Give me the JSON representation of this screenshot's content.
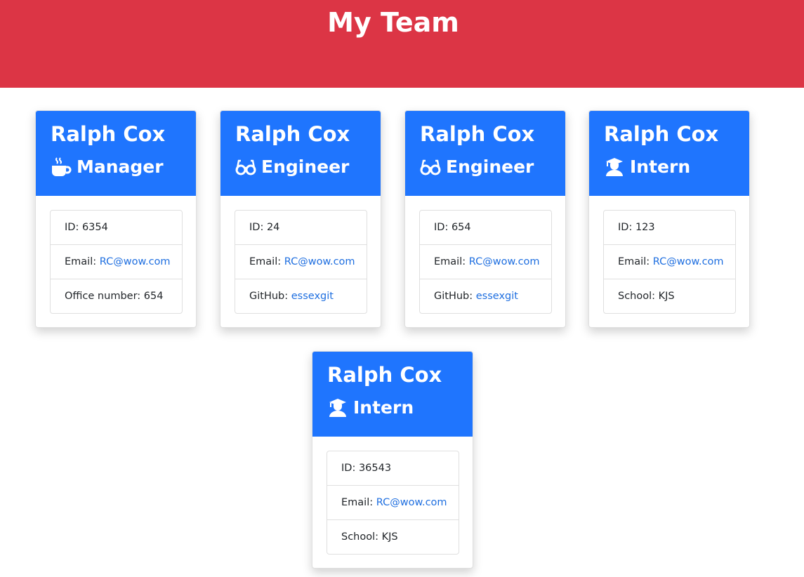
{
  "header": {
    "title": "My Team"
  },
  "cards": [
    {
      "name": "Ralph Cox",
      "role": "Manager",
      "role_icon": "mug-hot-icon",
      "id_label": "ID: ",
      "id": "6354",
      "email_label": "Email: ",
      "email": "RC@wow.com",
      "extra_label": "Office number: ",
      "extra_value": "654"
    },
    {
      "name": "Ralph Cox",
      "role": "Engineer",
      "role_icon": "glasses-icon",
      "id_label": "ID: ",
      "id": "24",
      "email_label": "Email: ",
      "email": "RC@wow.com",
      "extra_label": "GitHub: ",
      "extra_value": "essexgit"
    },
    {
      "name": "Ralph Cox",
      "role": "Engineer",
      "role_icon": "glasses-icon",
      "id_label": "ID: ",
      "id": "654",
      "email_label": "Email: ",
      "email": "RC@wow.com",
      "extra_label": "GitHub: ",
      "extra_value": "essexgit"
    },
    {
      "name": "Ralph Cox",
      "role": "Intern",
      "role_icon": "user-graduate-icon",
      "id_label": "ID: ",
      "id": "123",
      "email_label": "Email: ",
      "email": "RC@wow.com",
      "extra_label": "School: ",
      "extra_value": "KJS"
    },
    {
      "name": "Ralph Cox",
      "role": "Intern",
      "role_icon": "user-graduate-icon",
      "id_label": "ID: ",
      "id": "36543",
      "email_label": "Email: ",
      "email": "RC@wow.com",
      "extra_label": "School: ",
      "extra_value": "KJS"
    }
  ],
  "colors": {
    "header_bg": "#dc3545",
    "card_header_bg": "#1f75fe",
    "link": "#1f6fe0"
  }
}
